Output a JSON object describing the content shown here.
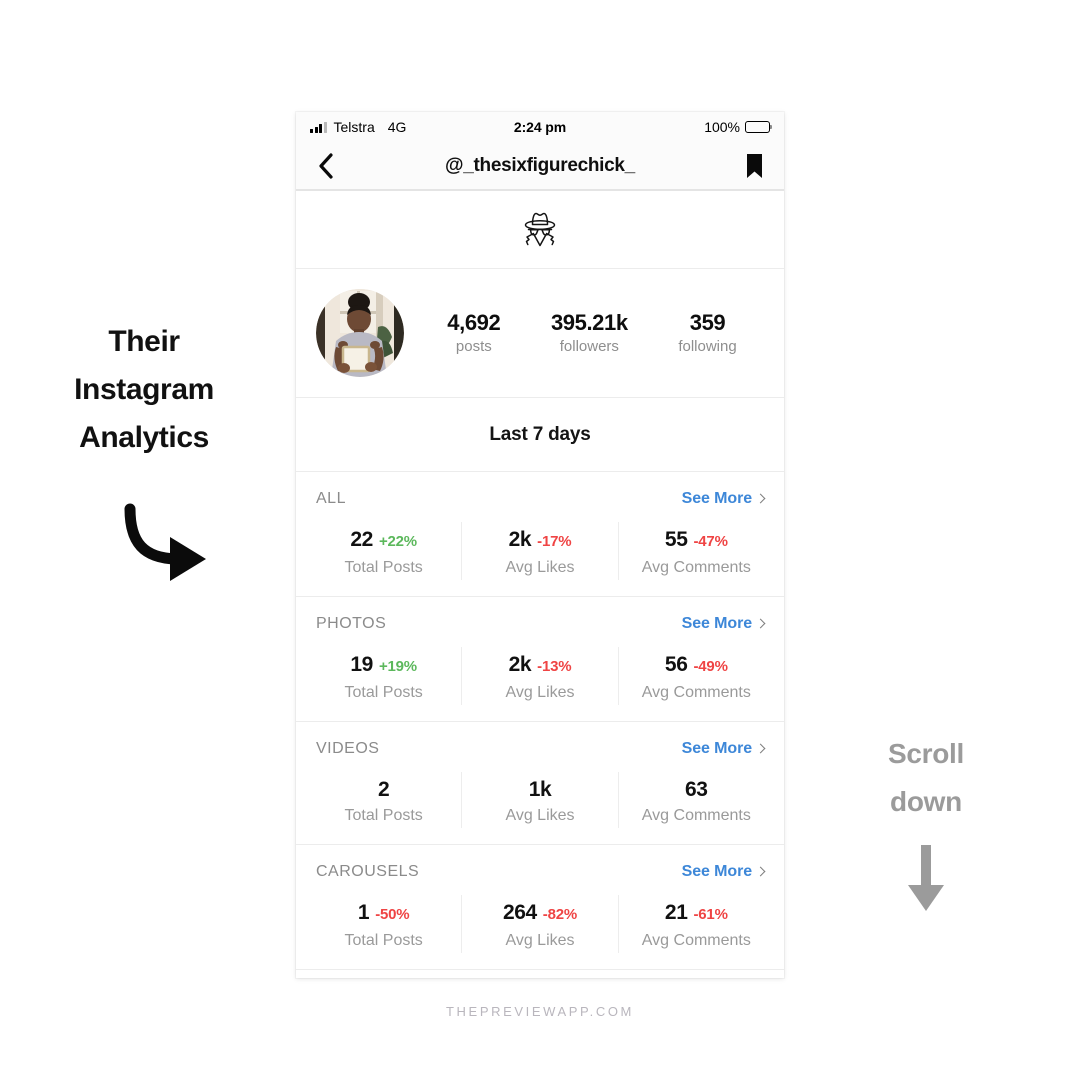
{
  "promo": {
    "lines": [
      "Their",
      "Instagram",
      "Analytics"
    ],
    "arrow_icon": "curved-arrow-down-right-icon"
  },
  "scroll_hint": {
    "lines": [
      "Scroll",
      "down"
    ],
    "arrow_icon": "arrow-down-icon",
    "color": "#9b9b9b"
  },
  "footer": {
    "brand": "THEPREVIEWAPP.COM"
  },
  "phone": {
    "status_bar": {
      "carrier": "Telstra",
      "network": "4G",
      "time": "2:24 pm",
      "battery_percent": "100%",
      "signal_icon": "signal-bars-icon",
      "battery_icon": "battery-full-icon"
    },
    "nav_bar": {
      "back_icon": "chevron-left-icon",
      "title": "@_thesixfigurechick_",
      "bookmark_icon": "bookmark-filled-icon"
    },
    "incognito": {
      "icon": "incognito-spy-icon"
    },
    "profile": {
      "avatar_icon": "profile-avatar",
      "stats": [
        {
          "value": "4,692",
          "label": "posts"
        },
        {
          "value": "395.21k",
          "label": "followers"
        },
        {
          "value": "359",
          "label": "following"
        }
      ]
    },
    "period": {
      "title": "Last 7 days"
    },
    "see_more_label": "See More",
    "see_more_color": "#3d87d8",
    "chevron_icon": "chevron-right-icon",
    "sections": [
      {
        "title": "ALL",
        "metrics": [
          {
            "value": "22",
            "delta": "+22%",
            "direction": "up",
            "label": "Total Posts"
          },
          {
            "value": "2k",
            "delta": "-17%",
            "direction": "down",
            "label": "Avg Likes"
          },
          {
            "value": "55",
            "delta": "-47%",
            "direction": "down",
            "label": "Avg Comments"
          }
        ]
      },
      {
        "title": "PHOTOS",
        "metrics": [
          {
            "value": "19",
            "delta": "+19%",
            "direction": "up",
            "label": "Total Posts"
          },
          {
            "value": "2k",
            "delta": "-13%",
            "direction": "down",
            "label": "Avg Likes"
          },
          {
            "value": "56",
            "delta": "-49%",
            "direction": "down",
            "label": "Avg Comments"
          }
        ]
      },
      {
        "title": "VIDEOS",
        "metrics": [
          {
            "value": "2",
            "delta": "",
            "direction": "none",
            "label": "Total Posts"
          },
          {
            "value": "1k",
            "delta": "",
            "direction": "none",
            "label": "Avg Likes"
          },
          {
            "value": "63",
            "delta": "",
            "direction": "none",
            "label": "Avg Comments"
          }
        ]
      },
      {
        "title": "CAROUSELS",
        "metrics": [
          {
            "value": "1",
            "delta": "-50%",
            "direction": "down",
            "label": "Total Posts"
          },
          {
            "value": "264",
            "delta": "-82%",
            "direction": "down",
            "label": "Avg Likes"
          },
          {
            "value": "21",
            "delta": "-61%",
            "direction": "down",
            "label": "Avg Comments"
          }
        ]
      }
    ]
  }
}
